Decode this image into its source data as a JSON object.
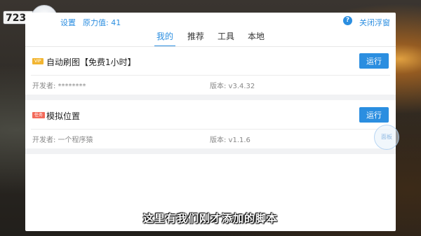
{
  "overlay": {
    "level": "723",
    "float_badge": "面板"
  },
  "topbar": {
    "settings_label": "设置",
    "power_label": "原力值: 41",
    "help_icon": "?",
    "close_float_label": "关闭浮窗"
  },
  "tabs": [
    {
      "label": "我的",
      "active": true
    },
    {
      "label": "推荐",
      "active": false
    },
    {
      "label": "工具",
      "active": false
    },
    {
      "label": "本地",
      "active": false
    }
  ],
  "scripts": [
    {
      "tag": "VIP",
      "title": "自动刷图【免费1小时】",
      "run_label": "运行",
      "developer": "开发者: ********",
      "version": "版本: v3.4.32"
    },
    {
      "tag": "任务",
      "title": "模拟位置",
      "run_label": "运行",
      "developer": "开发者: 一个程序猿",
      "version": "版本: v1.1.6"
    }
  ],
  "subtitle": "这里有我们刚才添加的脚本",
  "colors": {
    "accent": "#2b8ee0",
    "vip_tag": "#f2b531",
    "task_tag": "#f36a5a"
  }
}
